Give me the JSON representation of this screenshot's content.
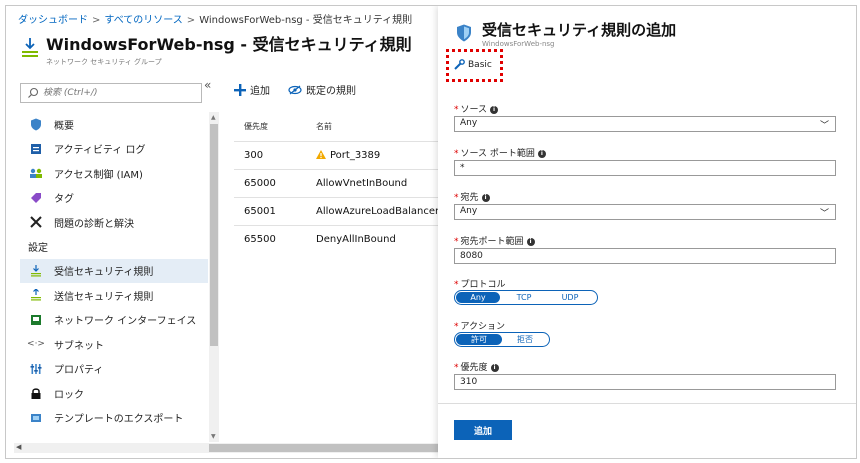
{
  "breadcrumb": {
    "items": [
      "ダッシュボード",
      "すべてのリソース",
      "WindowsForWeb-nsg - 受信セキュリティ規則"
    ],
    "separator": ">"
  },
  "header": {
    "title": "WindowsForWeb-nsg - 受信セキュリティ規則",
    "subtitle": "ネットワーク セキュリティ グループ"
  },
  "search": {
    "placeholder": "検索 (Ctrl+/)"
  },
  "nav": {
    "collapse": "«",
    "items": [
      {
        "label": "概要",
        "icon": "shield-icon"
      },
      {
        "label": "アクティビティ ログ",
        "icon": "log-icon"
      },
      {
        "label": "アクセス制御 (IAM)",
        "icon": "people-icon"
      },
      {
        "label": "タグ",
        "icon": "tag-icon"
      },
      {
        "label": "問題の診断と解決",
        "icon": "wrench-icon"
      }
    ],
    "section": "設定",
    "settings_items": [
      {
        "label": "受信セキュリティ規則",
        "icon": "inbound-icon"
      },
      {
        "label": "送信セキュリティ規則",
        "icon": "outbound-icon"
      },
      {
        "label": "ネットワーク インターフェイス",
        "icon": "nic-icon"
      },
      {
        "label": "サブネット",
        "icon": "subnet-icon"
      },
      {
        "label": "プロパティ",
        "icon": "properties-icon"
      },
      {
        "label": "ロック",
        "icon": "lock-icon"
      },
      {
        "label": "テンプレートのエクスポート",
        "icon": "export-icon"
      }
    ]
  },
  "toolbar": {
    "add_label": "追加",
    "default_rules_label": "既定の規則"
  },
  "rules_table": {
    "columns": [
      "優先度",
      "名前"
    ],
    "rows": [
      {
        "priority": "300",
        "name": "Port_3389",
        "warning": true
      },
      {
        "priority": "65000",
        "name": "AllowVnetInBound",
        "warning": false
      },
      {
        "priority": "65001",
        "name": "AllowAzureLoadBalancerInB",
        "warning": false
      },
      {
        "priority": "65500",
        "name": "DenyAllInBound",
        "warning": false
      }
    ]
  },
  "panel": {
    "title": "受信セキュリティ規則の追加",
    "subtitle": "WindowsForWeb-nsg",
    "tab_basic": "Basic",
    "fields": {
      "source": {
        "label": "ソース",
        "value": "Any"
      },
      "source_port": {
        "label": "ソース ポート範囲",
        "value": "*"
      },
      "destination": {
        "label": "宛先",
        "value": "Any"
      },
      "destination_port": {
        "label": "宛先ポート範囲",
        "value": "8080"
      },
      "protocol": {
        "label": "プロトコル",
        "options": [
          "Any",
          "TCP",
          "UDP"
        ],
        "selected": "Any"
      },
      "action": {
        "label": "アクション",
        "options": [
          "許可",
          "拒否"
        ],
        "selected": "許可"
      },
      "priority": {
        "label": "優先度",
        "value": "310"
      }
    },
    "add_button": "追加"
  },
  "colors": {
    "accent": "#0c63b8",
    "highlight": "#e00000",
    "warning": "#f2a900"
  }
}
